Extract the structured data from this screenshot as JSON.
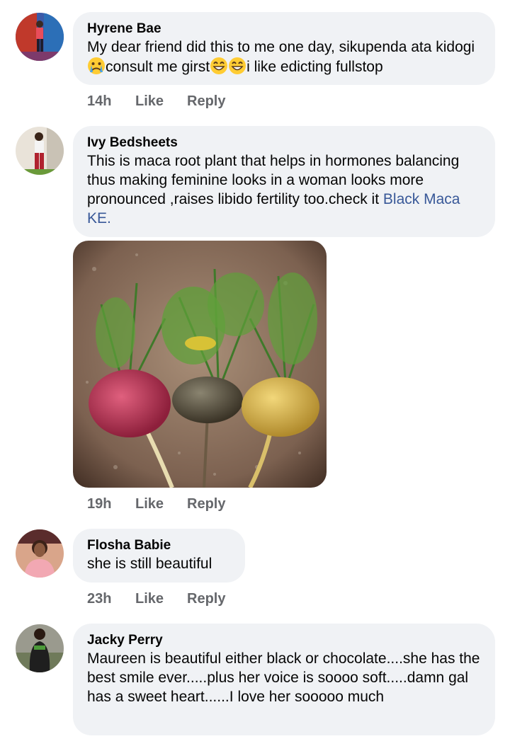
{
  "comments": [
    {
      "author": "Hyrene Bae",
      "text_part1": "My dear friend did this to me one day, sikupenda ata kidogi",
      "text_part2": "consult me girst",
      "text_part3": "i like edicting fullstop",
      "time": "14h",
      "like": "Like",
      "reply": "Reply"
    },
    {
      "author": "Ivy Bedsheets",
      "text": "This is maca root plant that helps in hormones balancing thus making feminine looks in a woman looks more pronounced ,raises libido fertility too.check it ",
      "link": "Black Maca KE.",
      "time": "19h",
      "like": "Like",
      "reply": "Reply"
    },
    {
      "author": "Flosha Babie",
      "text": "she is still beautiful",
      "time": "23h",
      "like": "Like",
      "reply": "Reply"
    },
    {
      "author": "Jacky Perry",
      "text": "Maureen is beautiful either black or chocolate....she has the best smile ever.....plus her voice is soooo soft.....damn gal has a sweet heart......I love her sooooo much"
    }
  ],
  "colors": {
    "bubble_bg": "#f0f2f5",
    "link": "#385898",
    "meta": "#65676b"
  }
}
